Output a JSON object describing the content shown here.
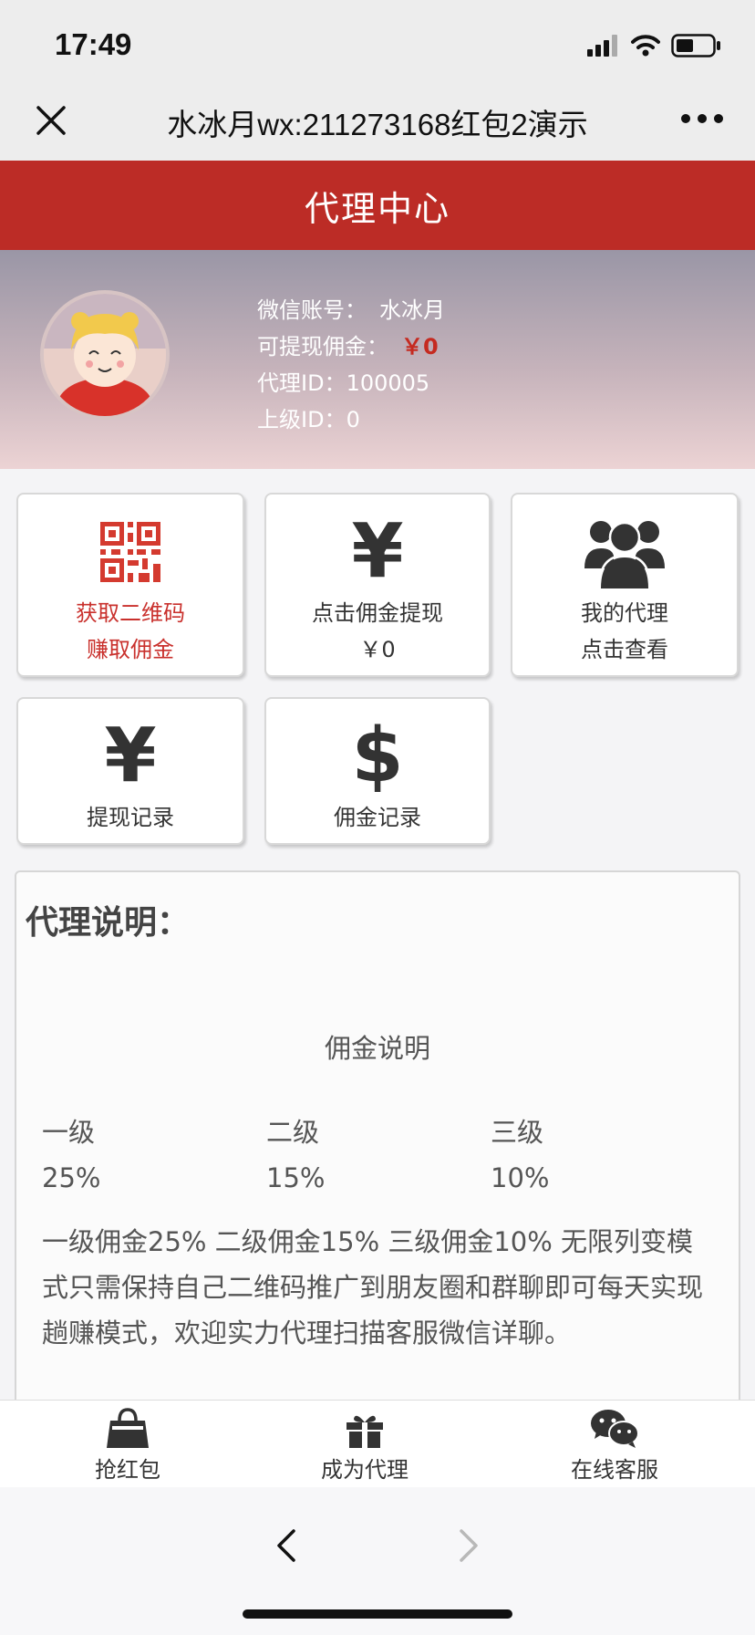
{
  "status": {
    "time": "17:49"
  },
  "wx": {
    "title": "水冰月wx:211273168红包2演示"
  },
  "header": {
    "title": "代理中心"
  },
  "profile": {
    "wechat_label": "微信账号：",
    "wechat_value": "水冰月",
    "commission_label": "可提现佣金：",
    "commission_value": "￥0",
    "agent_id_label": "代理ID：",
    "agent_id_value": "100005",
    "parent_id_label": "上级ID：",
    "parent_id_value": "0"
  },
  "cards": {
    "qrcode": {
      "line1": "获取二维码",
      "line2": "赚取佣金"
    },
    "withdraw": {
      "glyph": "¥",
      "line1": "点击佣金提现",
      "line2": "￥0"
    },
    "my_agents": {
      "line1": "我的代理",
      "line2": "点击查看"
    },
    "withdraw_records": {
      "glyph": "¥",
      "line1": "提现记录"
    },
    "commission_records": {
      "glyph": "$",
      "line1": "佣金记录"
    }
  },
  "explain": {
    "title": "代理说明：",
    "subtitle": "佣金说明",
    "levels": [
      {
        "name": "一级",
        "rate": "25%"
      },
      {
        "name": "二级",
        "rate": "15%"
      },
      {
        "name": "三级",
        "rate": "10%"
      }
    ],
    "description": "一级佣金25% 二级佣金15% 三级佣金10% 无限列变模式只需保持自己二维码推广到朋友圈和群聊即可每天实现趟赚模式，欢迎实力代理扫描客服微信详聊。"
  },
  "tabbar": {
    "items": [
      {
        "label": "抢红包",
        "icon": "shopping-bag-icon"
      },
      {
        "label": "成为代理",
        "icon": "gift-icon"
      },
      {
        "label": "在线客服",
        "icon": "wechat-chat-icon"
      }
    ]
  },
  "colors": {
    "brand_red": "#bc2c26",
    "accent_red": "#c9302c"
  }
}
